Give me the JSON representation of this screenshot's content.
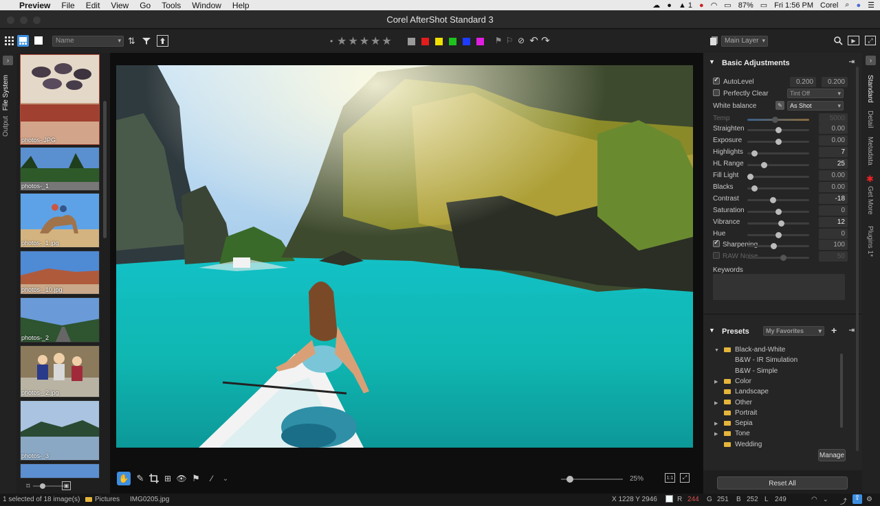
{
  "menubar": {
    "app": "Preview",
    "items": [
      "File",
      "Edit",
      "View",
      "Go",
      "Tools",
      "Window",
      "Help"
    ],
    "battery": "87%",
    "clock": "Fri 1:56 PM",
    "user": "Corel",
    "notif_count": "1"
  },
  "window": {
    "title": "Corel AfterShot Standard 3"
  },
  "toolbar": {
    "sort_value": "Name",
    "layer_value": "Main Layer",
    "rating_dot": "•",
    "stars": [
      "★",
      "★",
      "★",
      "★",
      "★"
    ],
    "color_labels": [
      "#9a9a9a",
      "#e31c1c",
      "#f0e000",
      "#1ec31e",
      "#1e3cff",
      "#e01ee0"
    ]
  },
  "left_tabs": [
    "File System",
    "Output"
  ],
  "filmstrip": {
    "thumbs": [
      "photos-.JPG",
      "photos-_1",
      "photos-_1.jpg",
      "photos-_10.jpg",
      "photos-_2",
      "photos-_2.jpg",
      "photos-_3",
      ""
    ]
  },
  "viewer": {
    "zoom": "25%"
  },
  "basic": {
    "title": "Basic Adjustments",
    "autolevel_label": "AutoLevel",
    "autolevel_v1": "0.200",
    "autolevel_v2": "0.200",
    "perfectly_clear_label": "Perfectly Clear",
    "tint_value": "Tint Off",
    "wb_label": "White balance",
    "wb_value": "As Shot",
    "temp_label": "Temp",
    "temp_value": "5000",
    "sliders": [
      {
        "label": "Straighten",
        "value": "0.00",
        "pos": 0.5
      },
      {
        "label": "Exposure",
        "value": "0.00",
        "pos": 0.5
      },
      {
        "label": "Highlights",
        "value": "7",
        "pos": 0.07
      },
      {
        "label": "HL Range",
        "value": "25",
        "pos": 0.25
      },
      {
        "label": "Fill Light",
        "value": "0.00",
        "pos": 0.0
      },
      {
        "label": "Blacks",
        "value": "0.00",
        "pos": 0.08
      },
      {
        "label": "Contrast",
        "value": "-18",
        "pos": 0.41
      },
      {
        "label": "Saturation",
        "value": "0",
        "pos": 0.5
      },
      {
        "label": "Vibrance",
        "value": "12",
        "pos": 0.56
      },
      {
        "label": "Hue",
        "value": "0",
        "pos": 0.5
      }
    ],
    "sharpening_label": "Sharpening",
    "sharpening_value": "100",
    "rawnoise_label": "RAW Noise",
    "rawnoise_value": "50",
    "keywords_label": "Keywords"
  },
  "presets": {
    "title": "Presets",
    "dropdown": "My Favorites",
    "items": [
      {
        "label": "Black-and-White",
        "type": "folder-open"
      },
      {
        "label": "B&W - IR Simulation",
        "type": "child"
      },
      {
        "label": "B&W - Simple",
        "type": "child"
      },
      {
        "label": "Color",
        "type": "folder"
      },
      {
        "label": "Landscape",
        "type": "folder-leaf"
      },
      {
        "label": "Other",
        "type": "folder"
      },
      {
        "label": "Portrait",
        "type": "folder-leaf"
      },
      {
        "label": "Sepia",
        "type": "folder"
      },
      {
        "label": "Tone",
        "type": "folder"
      },
      {
        "label": "Wedding",
        "type": "folder-leaf"
      }
    ],
    "manage_label": "Manage"
  },
  "reset_all": "Reset All",
  "right_tabs": [
    "Standard",
    "Detail",
    "Metadata",
    "Get More",
    "Plugins 1*"
  ],
  "status": {
    "selection": "1 selected of 18 image(s)",
    "folder": "Pictures",
    "filename": "IMG0205.jpg",
    "coords": "X 1228  Y 2946",
    "r_label": "R",
    "r_value": "244",
    "g_label": "G",
    "g_value": "251",
    "b_label": "B",
    "b_value": "252",
    "l_label": "L",
    "l_value": "249"
  }
}
